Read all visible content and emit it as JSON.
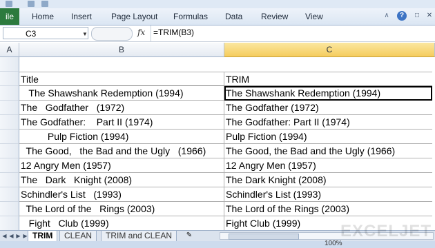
{
  "ribbon": {
    "file_label": "ile",
    "tabs": [
      "Home",
      "Insert",
      "Page Layout",
      "Formulas",
      "Data",
      "Review",
      "View"
    ]
  },
  "formula_bar": {
    "name_box": "C3",
    "fx_label": "fx",
    "formula": "=TRIM(B3)"
  },
  "columns": {
    "a": "A",
    "b": "B",
    "c": "C"
  },
  "table": {
    "header_title": "Title",
    "header_trim": "TRIM",
    "rows": [
      {
        "title": "   The Shawshank Redemption (1994)",
        "trim": "The Shawshank Redemption (1994)"
      },
      {
        "title": "The   Godfather   (1972)",
        "trim": "The Godfather (1972)"
      },
      {
        "title": "The Godfather:    Part II (1974)",
        "trim": "The Godfather: Part II (1974)"
      },
      {
        "title": "          Pulp Fiction (1994)",
        "trim": "Pulp Fiction (1994)"
      },
      {
        "title": "  The Good,   the Bad and the Ugly   (1966)",
        "trim": "The Good, the Bad and the Ugly (1966)"
      },
      {
        "title": "12 Angry Men (1957)",
        "trim": "12 Angry Men (1957)"
      },
      {
        "title": "The   Dark   Knight (2008)",
        "trim": "The Dark Knight (2008)"
      },
      {
        "title": "Schindler's List   (1993)",
        "trim": "Schindler's List (1993)"
      },
      {
        "title": "  The Lord of the   Rings (2003)",
        "trim": "The Lord of the Rings (2003)"
      },
      {
        "title": "   Fight   Club (1999)",
        "trim": "Fight Club (1999)"
      }
    ]
  },
  "sheets": [
    "TRIM",
    "CLEAN",
    "TRIM and CLEAN"
  ],
  "active_sheet": "TRIM",
  "status": {
    "zoom": "100%"
  },
  "watermark": "EXCELJET",
  "colors": {
    "file_tab": "#2c7a3d",
    "active_col": "#f5cc5d",
    "ribbon": "#dbe6f3"
  }
}
